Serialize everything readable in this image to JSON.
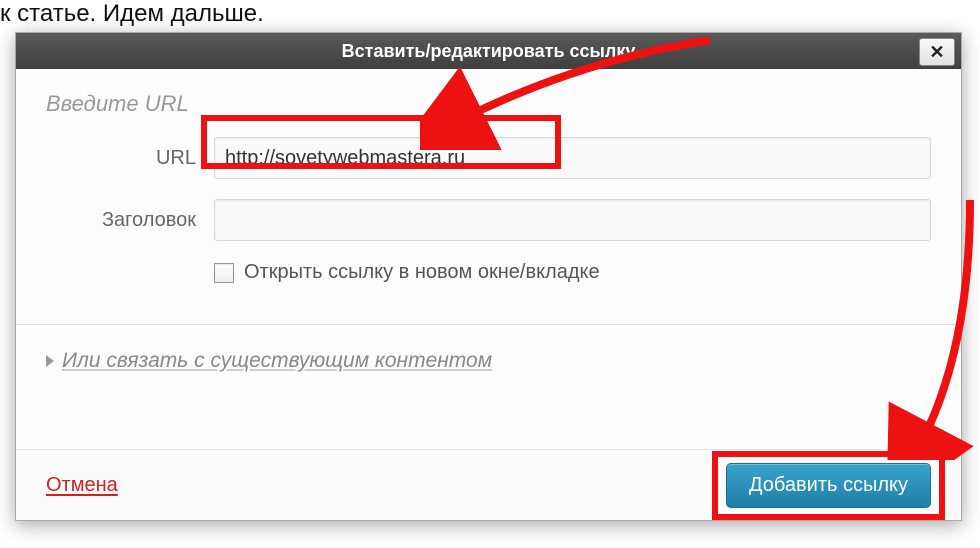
{
  "background": {
    "top_text": "к статье. Идем дальше."
  },
  "dialog": {
    "title": "Вставить/редактировать ссылку",
    "close_symbol": "✕",
    "section_heading": "Введите URL",
    "url_label": "URL",
    "url_value": "http://sovetywebmastera.ru",
    "title_label": "Заголовок",
    "title_value": "",
    "checkbox_label": "Открыть ссылку в новом окне/вкладке",
    "link_existing": "Или связать с существующим контентом",
    "cancel": "Отмена",
    "submit": "Добавить ссылку"
  }
}
